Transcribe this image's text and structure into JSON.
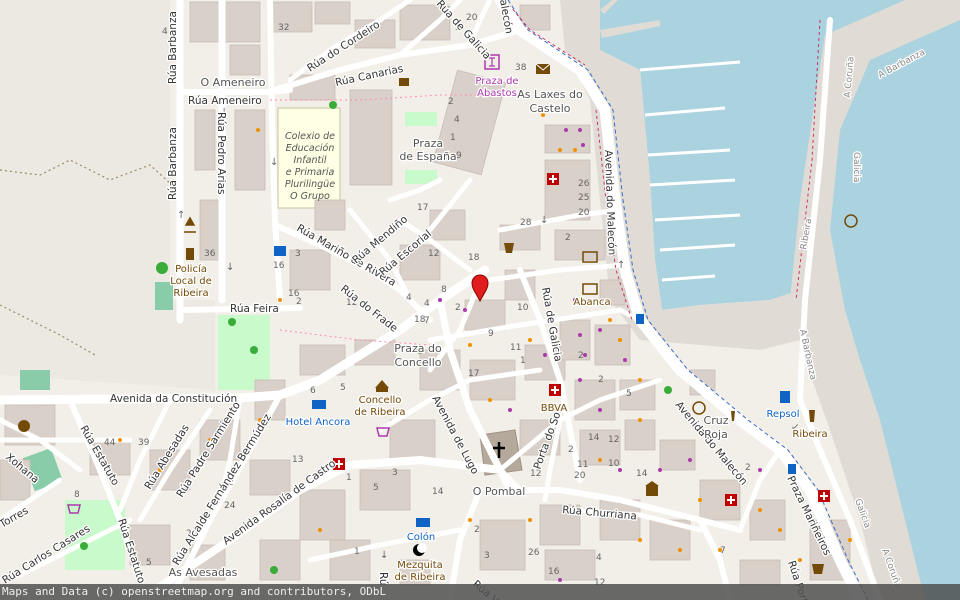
{
  "map": {
    "colors": {
      "land": "#f2efe9",
      "water": "#aad3df",
      "building": "#d9d0c9",
      "road": "#ffffff",
      "pier": "#e0dcd5",
      "school": "#ffffe5",
      "park": "#c8facc"
    },
    "streets": {
      "barbanza_1": "Rúa Barbanza",
      "barbanza_2": "Rúa Barbanza",
      "cordeiro": "Rúa do Cordeiro",
      "canarias": "Rúa Canarias",
      "galicia_top": "Rúa de Galicia",
      "ameneiro": "Rúa Ameneiro",
      "pedro_arias": "Rúa Pedro Arias",
      "marino": "Rúa Mariño de Rivera",
      "mendino": "Rúa Mendiño",
      "escorial": "Rúa Escorial",
      "frade": "Rúa do Frade",
      "feira": "Rúa Feira",
      "constitucion": "Avenida da Constitución",
      "malecon_1": "Avenida do Malecón",
      "malecon_2": "Avenida do Malecón",
      "galicia_mid": "Rúa de Galicia",
      "lugo": "Avenida de Lugo",
      "porta_sol": "Porta do Sol",
      "churriana": "Rúa Churriana",
      "abesadas": "Rúa Abesadas",
      "padre_sarmiento": "Rúa Padre Sarmiento",
      "alcalde": "Rúa Alcalde Fernández Bermúdez",
      "rosalia": "Avenida Rosalía de Castro",
      "estatuto_1": "Rúa Estatuto",
      "estatuto_2": "Rúa Estatuto",
      "carlos": "Rúa Carlos Casares",
      "torres": "Torres",
      "xohana": "Xohana",
      "marineiros": "Praza Mariñeiros",
      "barbanza_east": "A Barbanza",
      "coruna_1": "A Coruña",
      "galicia_east": "Galicia",
      "ribeira_road": "Ribeira",
      "barbanza_east2": "A Barbanza",
      "galicia_east2": "Galicia",
      "coruna_2": "A Coruña",
      "malecon_top": "alecón",
      "rua_v": "Rúa V",
      "rua_r": "Rú",
      "rua_port": "Rúa Port"
    },
    "places": {
      "ameneiro": "O Ameneiro",
      "espana_1": "Praza",
      "espana_2": "de España",
      "concello_1": "Praza do",
      "concello_2": "Concello",
      "laxes_1": "As Laxes do",
      "laxes_2": "Castelo",
      "pombal": "O Pombal",
      "avesadas": "As Avesadas",
      "cruz_1": "Cruz",
      "cruz_2": "Roja"
    },
    "pois": {
      "abastos_1": "Praza de",
      "abastos_2": "Abastos",
      "policia_1": "Policía",
      "policia_2": "Local de",
      "policia_3": "Ribeira",
      "concello_ribeira_1": "Concello",
      "concello_ribeira_2": "de Ribeira",
      "hotel": "Hotel Ancora",
      "colon": "Colón",
      "mezquita_1": "Mezquita",
      "mezquita_2": "de Ribeira",
      "bbva": "BBVA",
      "abanca": "Abanca",
      "repsol": "Repsol",
      "ribeira": "Ribeira"
    },
    "school": [
      "Colexio de",
      "Educación",
      "Infantil",
      "e Primaria",
      "Plurilingüe",
      "O Grupo"
    ],
    "house_numbers": [
      "32",
      "4",
      "3",
      "20",
      "38",
      "2",
      "4",
      "1",
      "9",
      "17",
      "36",
      "16",
      "28",
      "18",
      "2",
      "12",
      "8",
      "4",
      "7",
      "3",
      "2",
      "4",
      "18",
      "26",
      "25",
      "20",
      "2",
      "16",
      "12",
      "10",
      "9",
      "17",
      "11",
      "1",
      "6",
      "5",
      "14",
      "12",
      "20",
      "2",
      "11",
      "2",
      "2",
      "5",
      "10",
      "14",
      "12",
      "2",
      "1",
      "5",
      "3",
      "14",
      "16",
      "26",
      "3",
      "4",
      "5",
      "1",
      "44",
      "39",
      "8",
      "2",
      "13",
      "24",
      "20",
      "12",
      "7",
      "2"
    ]
  },
  "attribution": "Maps and Data (c) openstreetmap.org and contributors, ODbL"
}
